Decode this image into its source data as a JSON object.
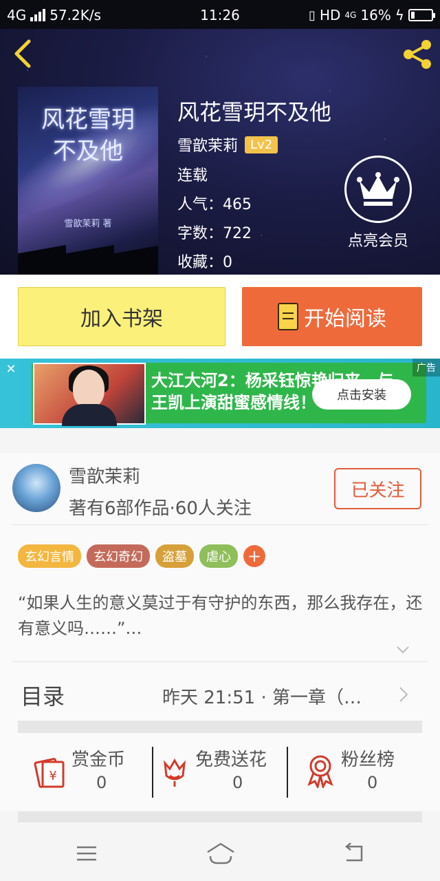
{
  "status_bar": {
    "network": "4G",
    "speed": "57.2K/s",
    "time": "11:26",
    "hd": "HD",
    "network_small": "4G",
    "battery": "16%"
  },
  "book": {
    "title": "风花雪玥不及他",
    "author": "雪歆茉莉",
    "level": "Lv2",
    "status": "连载",
    "popularity": "人气：465",
    "word_count": "字数：722",
    "favorites": "收藏：0",
    "cover_title_line1": "风花雪玥",
    "cover_title_line2": "不及他",
    "cover_author": "雪歆茉莉 著"
  },
  "vip": {
    "label": "点亮会员"
  },
  "actions": {
    "add_shelf": "加入书架",
    "start_read": "开始阅读"
  },
  "ad": {
    "text_line1": "大江大河2：杨采钰惊艳归来，与",
    "text_line2": "王凯上演甜蜜感情线！",
    "install": "点击安装",
    "tag": "广告"
  },
  "author_card": {
    "name": "雪歆茉莉",
    "summary": "著有6部作品·60人关注",
    "follow": "已关注"
  },
  "tags": [
    {
      "label": "玄幻言情",
      "color": "#f3b63f"
    },
    {
      "label": "玄幻奇幻",
      "color": "#c46a5a"
    },
    {
      "label": "盗墓",
      "color": "#d6a13a"
    },
    {
      "label": "虐心",
      "color": "#8fbf5a"
    }
  ],
  "intro": "“如果人生的意义莫过于有守护的东西，那么我存在，还有意义吗……”…",
  "toc": {
    "label": "目录",
    "latest": "昨天 21:51 · 第一章（…"
  },
  "stats": [
    {
      "label": "赏金币",
      "value": "0"
    },
    {
      "label": "免费送花",
      "value": "0"
    },
    {
      "label": "粉丝榜",
      "value": "0"
    }
  ],
  "colors": {
    "accent": "#ef6a3b",
    "shelf_button": "#fbf07a",
    "hero_bg": "#1b1c44"
  },
  "icons": {
    "back": "chevron-left-icon",
    "share": "share-icon",
    "vip": "crown-icon",
    "read": "book-icon",
    "coin": "red-envelope-icon",
    "flower": "flower-icon",
    "rank": "medal-icon"
  }
}
